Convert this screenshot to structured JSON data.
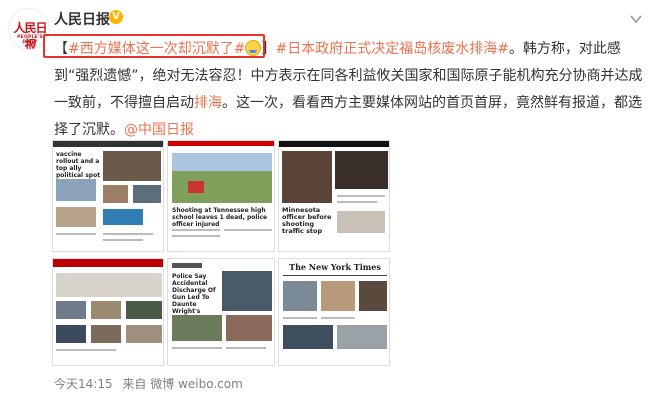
{
  "user": {
    "name": "人民日报",
    "avatar_logo_text": "人民日报",
    "avatar_logo_subtext": "PEOPLE'S DAILY",
    "verified_badge": "V"
  },
  "post": {
    "bracket_open": "【",
    "hashtag1": "#西方媒体这一次却沉默了#",
    "bracket_close": "】",
    "hashtag2": "#日本政府正式决定福岛核废水排海#",
    "text1": "。韩方称，对此感到“强烈遗憾”，绝对无法容忍！中方表示在同各利益攸关国家和国际原子能机构充分协商并达成一致前，不得擅自启动",
    "inline_link": "排海",
    "text2": "。这一次，看看西方主要媒体网站的首页首屏，竟然鲜有报道，都选择了沉默。",
    "mention": "@中国日报"
  },
  "thumbnails": {
    "t1_headline": "vaccine rollout and a top ally political spot",
    "t2_headline": "Shooting at Tennessee high school leaves 1 dead, police officer injured",
    "t3_headline": "Minnesota officer before shooting traffic stop",
    "t5_headline": "Police Say Accidental Discharge Of Gun Led To Daunte Wright's Death",
    "t6_masthead": "The New York Times"
  },
  "footer": {
    "time": "今天14:15",
    "source": "来自 微博 weibo.com"
  },
  "colors": {
    "accent": "#eb7350",
    "highlight_box": "#e8322c",
    "verified": "#ffb400",
    "logo_red": "#c8161d"
  }
}
